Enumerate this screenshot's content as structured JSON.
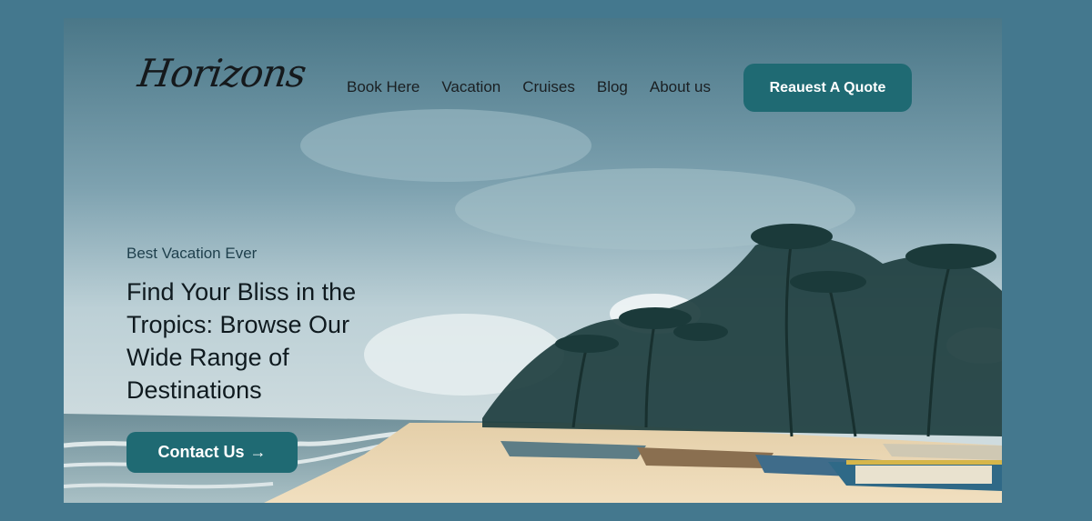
{
  "brand": {
    "logo_text": "Horizons"
  },
  "nav": {
    "items": [
      "Book Here",
      "Vacation",
      "Cruises",
      "Blog",
      "About us"
    ],
    "cta_label": "Reauest A Quote"
  },
  "hero": {
    "eyebrow": "Best Vacation Ever",
    "headline": "Find Your Bliss in the Tropics: Browse Our Wide Range of Destinations",
    "button_label": "Contact Us",
    "button_icon": "arrow-right-icon"
  },
  "colors": {
    "page_background": "#44788e",
    "accent": "#1f6a73",
    "text_dark": "#1a1f22"
  }
}
